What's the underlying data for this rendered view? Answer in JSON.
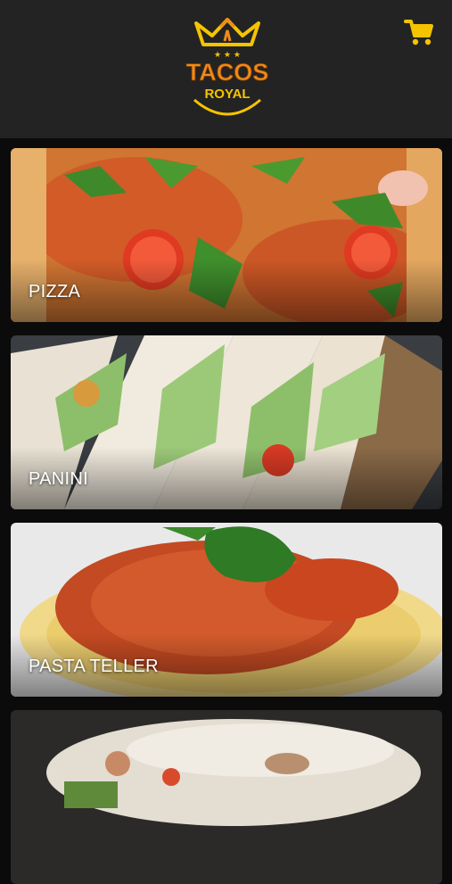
{
  "header": {
    "logo": {
      "line1": "TACOS",
      "line2": "ROYAL",
      "icon": "crown-logo-icon"
    },
    "cart": {
      "icon": "shopping-cart-icon"
    }
  },
  "colors": {
    "header_bg": "#232323",
    "page_bg": "#0b0b0b",
    "accent": "#f5c400",
    "logo_orange": "#f08a1c"
  },
  "categories": [
    {
      "label": "PIZZA"
    },
    {
      "label": "PANINI"
    },
    {
      "label": "PASTA TELLER"
    },
    {
      "label": ""
    }
  ]
}
